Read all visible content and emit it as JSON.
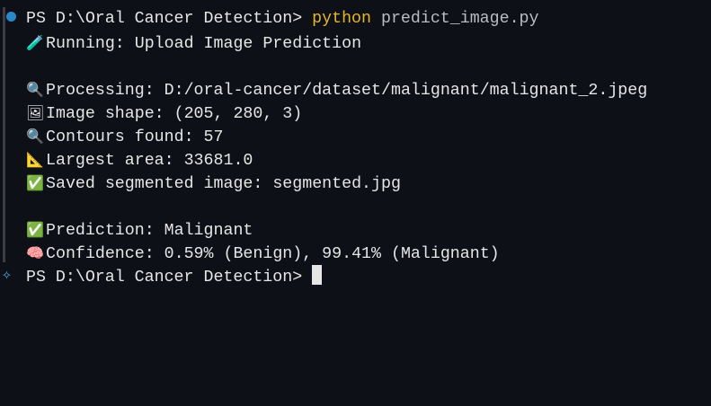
{
  "prompt": "PS D:\\Oral Cancer Detection> ",
  "command": {
    "exe": "python",
    "arg": "predict_image.py"
  },
  "output": [
    {
      "icon": "🧪",
      "icon_name": "test-tube-icon",
      "text": "Running: Upload Image Prediction"
    },
    {
      "icon": "🔍",
      "icon_name": "magnifier-icon",
      "text": "Processing: D:/oral-cancer/dataset/malignant/malignant_2.jpeg"
    },
    {
      "icon": "🖼",
      "icon_name": "picture-icon",
      "text": "Image shape: (205, 280, 3)"
    },
    {
      "icon": "🔍",
      "icon_name": "magnifier-icon",
      "text": "Contours found: 57"
    },
    {
      "icon": "📐",
      "icon_name": "triangle-ruler-icon",
      "text": "Largest area: 33681.0"
    },
    {
      "icon": "✅",
      "icon_name": "check-icon",
      "text": "Saved segmented image: segmented.jpg"
    },
    {
      "icon": "✅",
      "icon_name": "check-icon",
      "text": "Prediction: Malignant"
    },
    {
      "icon": "🧠",
      "icon_name": "brain-icon",
      "text": "Confidence: 0.59% (Benign), 99.41% (Malignant)"
    }
  ],
  "final_prompt": "PS D:\\Oral Cancer Detection> ",
  "colors": {
    "background": "#0e1017",
    "keyword": "#e5b628",
    "dot": "#2b88c8"
  }
}
